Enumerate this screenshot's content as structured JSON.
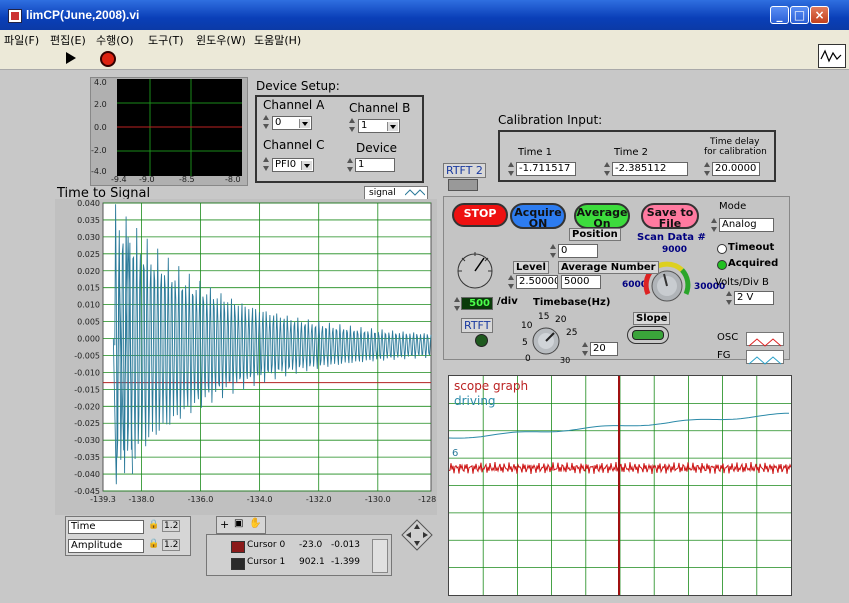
{
  "window": {
    "title": "limCP(June,2008).vi"
  },
  "menu": [
    "파일(F)",
    "편집(E)",
    "수행(O)",
    "도구(T)",
    "윈도우(W)",
    "도움말(H)"
  ],
  "minigraph": {
    "yticks": [
      "4.0",
      "2.0",
      "0.0",
      "-2.0",
      "-4.0"
    ],
    "xticks": [
      "-9.4",
      "-9.0",
      "-8.5",
      "-8.0"
    ]
  },
  "device_setup": {
    "title": "Device Setup:",
    "channel_a_label": "Channel A",
    "channel_a_value": "0",
    "channel_b_label": "Channel B",
    "channel_b_value": "1",
    "channel_c_label": "Channel C",
    "channel_c_value": "PFI0",
    "device_label": "Device",
    "device_value": "1"
  },
  "calibration": {
    "title": "Calibration Input:",
    "time1_label": "Time 1",
    "time1_value": "-1.711517",
    "time2_label": "Time 2",
    "time2_value": "-2.385112",
    "delay_label_1": "Time delay",
    "delay_label_2": "for calibration",
    "delay_value": "20.0000"
  },
  "rtft2": {
    "label": "RTFT 2"
  },
  "main_graph": {
    "title": "Time to Signal",
    "legend_label": "signal"
  },
  "controls": {
    "stop": "STOP",
    "acquire_1": "Acquire",
    "acquire_2": "ON",
    "average_1": "Average",
    "average_2": "On",
    "save_1": "Save to",
    "save_2": "File",
    "mode_label": "Mode",
    "mode_value": "Analog",
    "position_label": "Position",
    "position_value": "0",
    "scan_label": "Scan Data #",
    "scan_top": "9000",
    "scan_left": "6000",
    "scan_right": "30000",
    "timeout_label": "Timeout",
    "acquired_label": "Acquired",
    "level_label": "Level",
    "level_value": "2.50000",
    "avgnum_label": "Average Number",
    "avgnum_value": "5000",
    "volts_label": "Volts/Div B",
    "volts_value": "2 V",
    "div_value": "500",
    "div_label": "/div",
    "timebase_label": "Timebase(Hz)",
    "timebase_value": "20",
    "timebase_ticks": [
      "10",
      "15",
      "20",
      "25",
      "30",
      "5",
      "0"
    ],
    "slope_label": "Slope",
    "rtft_label": "RTFT",
    "osc_label": "OSC",
    "fg_label": "FG"
  },
  "scope": {
    "line1": "scope graph",
    "line2": "driving",
    "marker": "6"
  },
  "axis_palette": {
    "row1": "Time",
    "row2": "Amplitude"
  },
  "cursors": {
    "rows": [
      {
        "name": "Cursor 0",
        "x": "-23.0",
        "y": "-0.013"
      },
      {
        "name": "Cursor 1",
        "x": "902.1",
        "y": "-1.399"
      }
    ]
  },
  "colors": {
    "plot_bg": "#ffffff",
    "grid": "#1a8a1a",
    "signal": "#2b7a9a",
    "cursor_red": "#b22222",
    "stop_red": "#ee1111",
    "acquire_blue": "#2d7cf0",
    "average_green": "#3ddc3d",
    "save_pink": "#ff7aa0"
  },
  "chart_data": {
    "type": "line",
    "title": "Time to Signal",
    "xlabel": "",
    "ylabel": "",
    "xlim": [
      -139.3,
      -128.2
    ],
    "ylim": [
      -0.045,
      0.04
    ],
    "xticks": [
      "-139.3",
      "-138.0",
      "-136.0",
      "-134.0",
      "-132.0",
      "-130.0",
      "-128.2"
    ],
    "yticks": [
      "0.040",
      "0.035",
      "0.030",
      "0.025",
      "0.020",
      "0.015",
      "0.010",
      "0.005",
      "0.000",
      "-0.005",
      "-0.010",
      "-0.015",
      "-0.020",
      "-0.025",
      "-0.030",
      "-0.035",
      "-0.040",
      "-0.045"
    ],
    "cursor_y": -0.013,
    "series": [
      {
        "envelope": {
          "x_start": -138.9,
          "x_end": -128.2,
          "amp_start": 0.041,
          "amp_end": 0.002,
          "center": -0.002
        }
      }
    ]
  }
}
